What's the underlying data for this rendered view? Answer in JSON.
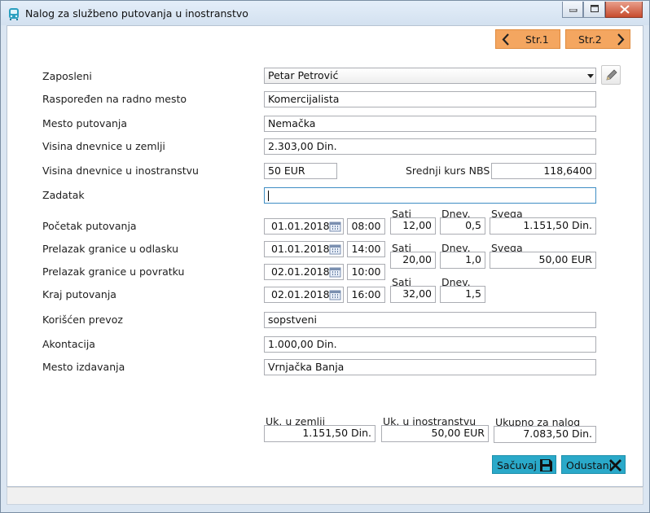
{
  "window": {
    "title": "Nalog za službeno putovanja u inostranstvo"
  },
  "nav": {
    "prev_label": "Str.1",
    "next_label": "Str.2"
  },
  "form": {
    "zaposleni": {
      "label": "Zaposleni",
      "value": "Petar Petrović"
    },
    "raspored": {
      "label": "Raspoređen na radno mesto",
      "value": "Komercijalista"
    },
    "mesto_putovanja": {
      "label": "Mesto putovanja",
      "value": "Nemačka"
    },
    "dnevnica_zemlja": {
      "label": "Visina dnevnice u zemlji",
      "value": "2.303,00 Din."
    },
    "dnevnica_ino": {
      "label": "Visina dnevnice u inostranstvu",
      "value": "50 EUR"
    },
    "kurs": {
      "label": "Srednji kurs NBS",
      "value": "118,6400"
    },
    "zadatak": {
      "label": "Zadatak",
      "value": ""
    },
    "pocetak": {
      "label": "Početak putovanja",
      "date": "01.01.2018",
      "time": "08:00"
    },
    "odlazak": {
      "label": "Prelazak granice u odlasku",
      "date": "01.01.2018",
      "time": "14:00"
    },
    "povratak": {
      "label": "Prelazak granice u povratku",
      "date": "02.01.2018",
      "time": "10:00"
    },
    "kraj": {
      "label": "Kraj putovanja",
      "date": "02.01.2018",
      "time": "16:00"
    },
    "calc_headers": {
      "sati": "Sati",
      "dnev": "Dnev.",
      "svega": "Svega"
    },
    "calc_row1": {
      "sati": "12,00",
      "dnev": "0,5",
      "svega": "1.151,50 Din."
    },
    "calc_row2": {
      "sati": "20,00",
      "dnev": "1,0",
      "svega": "50,00 EUR"
    },
    "calc_row3": {
      "sati": "32,00",
      "dnev": "1,5"
    },
    "prevoz": {
      "label": "Korišćen prevoz",
      "value": "sopstveni"
    },
    "akontacija": {
      "label": "Akontacija",
      "value": "1.000,00 Din."
    },
    "mesto_izdavanja": {
      "label": "Mesto izdavanja",
      "value": "Vrnjačka Banja"
    }
  },
  "totals": {
    "zemlja": {
      "label": "Uk. u zemlji",
      "value": "1.151,50 Din."
    },
    "ino": {
      "label": "Uk. u inostranstvu",
      "value": "50,00 EUR"
    },
    "ukupno": {
      "label": "Ukupno za nalog",
      "value": "7.083,50 Din."
    }
  },
  "actions": {
    "save_label": "Sačuvaj",
    "cancel_label": "Odustani"
  },
  "colors": {
    "nav_button": "#f4a660",
    "action_button": "#2aa9c9",
    "focus_border": "#3f8ec4"
  }
}
